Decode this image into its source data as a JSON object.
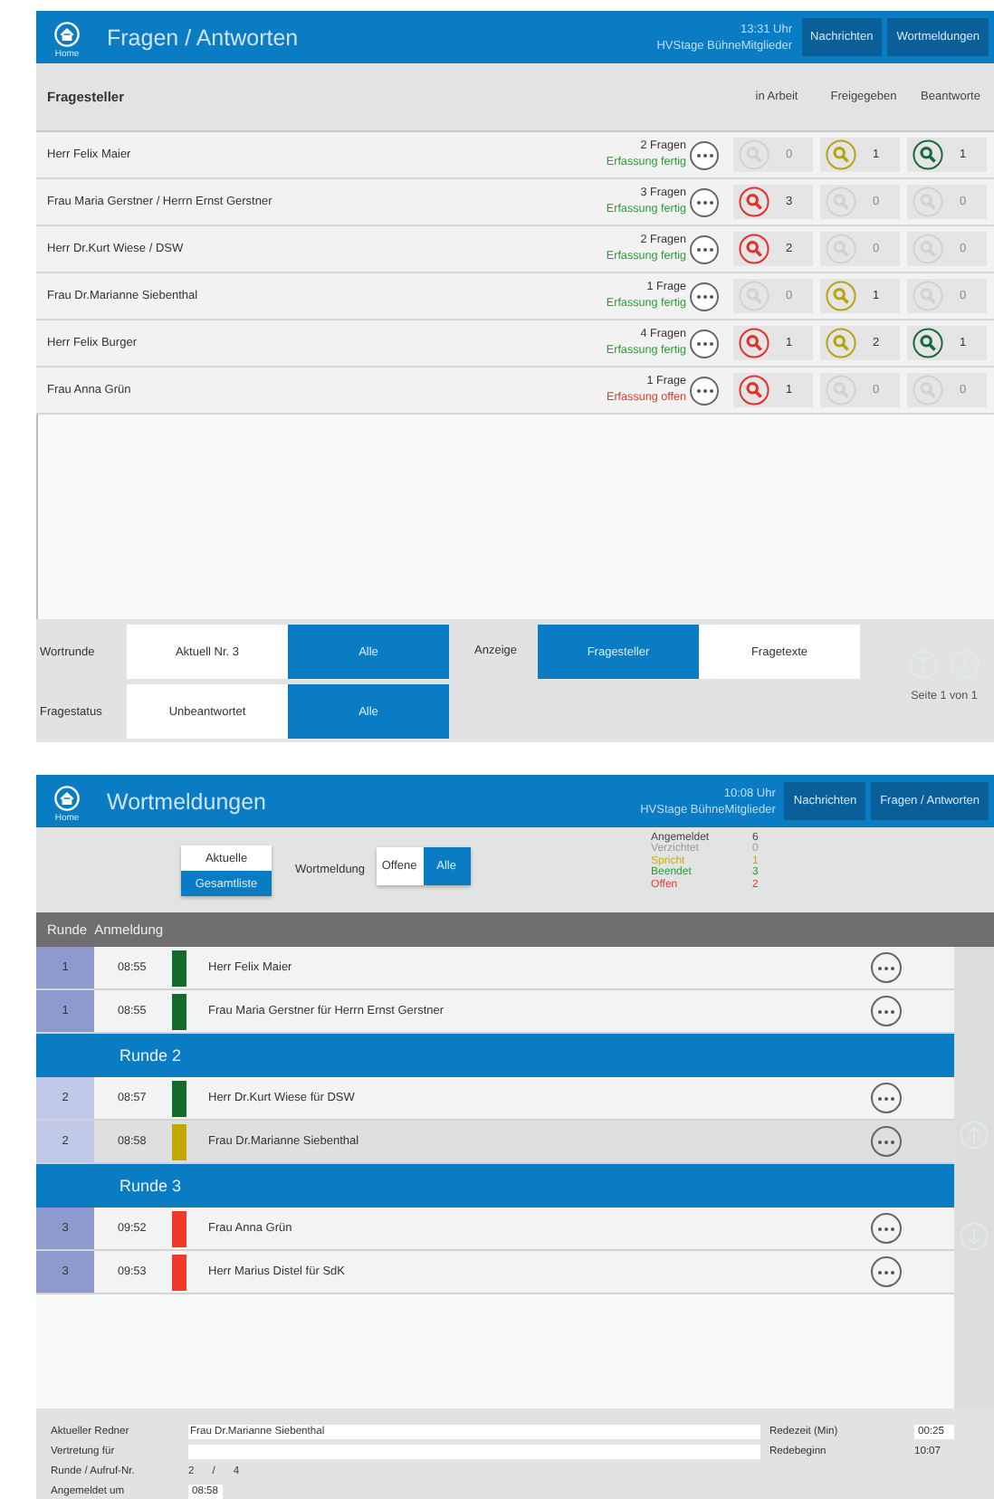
{
  "questions_screen": {
    "header": {
      "home_label": "Home",
      "title": "Fragen / Antworten",
      "time": "13:31 Uhr",
      "user": "HVStage BühneMitglieder",
      "nav_buttons": [
        "Nachrichten",
        "Wortmeldungen"
      ]
    },
    "table": {
      "columns": [
        {
          "label": "Fragesteller"
        },
        {
          "label": "in Arbeit",
          "color": "#e0322c"
        },
        {
          "label": "Freigegeben",
          "color": "#b7a412"
        },
        {
          "label": "Beantworte",
          "color": "#1a6a3a"
        }
      ],
      "rows": [
        {
          "name": "Herr Felix Maier",
          "questions": "2 Fragen",
          "status": "Erfassung fertig",
          "complete": true,
          "counts": [
            {
              "value": "0",
              "active": false
            },
            {
              "value": "1",
              "active": true
            },
            {
              "value": "1",
              "active": true
            }
          ]
        },
        {
          "name": "Frau Maria Gerstner / Herrn Ernst Gerstner",
          "questions": "3 Fragen",
          "status": "Erfassung fertig",
          "complete": true,
          "counts": [
            {
              "value": "3",
              "active": true
            },
            {
              "value": "0",
              "active": false
            },
            {
              "value": "0",
              "active": false
            }
          ]
        },
        {
          "name": "Herr Dr.Kurt Wiese / DSW",
          "questions": "2 Fragen",
          "status": "Erfassung fertig",
          "complete": true,
          "counts": [
            {
              "value": "2",
              "active": true
            },
            {
              "value": "0",
              "active": false
            },
            {
              "value": "0",
              "active": false
            }
          ]
        },
        {
          "name": "Frau Dr.Marianne Siebenthal",
          "questions": "1 Frage",
          "status": "Erfassung fertig",
          "complete": true,
          "counts": [
            {
              "value": "0",
              "active": false
            },
            {
              "value": "1",
              "active": true
            },
            {
              "value": "0",
              "active": false
            }
          ]
        },
        {
          "name": "Herr Felix Burger",
          "questions": "4 Fragen",
          "status": "Erfassung fertig",
          "complete": true,
          "counts": [
            {
              "value": "1",
              "active": true
            },
            {
              "value": "2",
              "active": true
            },
            {
              "value": "1",
              "active": true
            }
          ]
        },
        {
          "name": "Frau Anna Grün",
          "questions": "1 Frage",
          "status": "Erfassung offen",
          "complete": false,
          "counts": [
            {
              "value": "1",
              "active": true
            },
            {
              "value": "0",
              "active": false
            },
            {
              "value": "0",
              "active": false
            }
          ]
        }
      ]
    },
    "filters": [
      {
        "label": "Wortrunde",
        "options": [
          {
            "label": "Aktuell Nr. 3",
            "selected": false
          },
          {
            "label": "Alle",
            "selected": true
          }
        ]
      },
      {
        "label": "Fragestatus",
        "options": [
          {
            "label": "Unbeantwortet",
            "selected": false
          },
          {
            "label": "Alle",
            "selected": true
          }
        ]
      }
    ],
    "display": {
      "label": "Anzeige",
      "options": [
        {
          "label": "Fragesteller",
          "selected": true
        },
        {
          "label": "Fragetexte",
          "selected": false
        }
      ]
    },
    "pager": {
      "text": "Seite 1 von 1"
    }
  },
  "speakers_screen": {
    "header": {
      "home_label": "Home",
      "title": "Wortmeldungen",
      "time": "10:08 Uhr",
      "user": "HVStage BühneMitglieder",
      "nav_buttons": [
        "Nachrichten",
        "Fragen / Antworten"
      ]
    },
    "list_toggle": [
      {
        "label": "Aktuelle",
        "selected": false
      },
      {
        "label": "Gesamtliste",
        "selected": true
      }
    ],
    "filter": {
      "label": "Wortmeldung",
      "options": [
        {
          "label": "Offene",
          "selected": false
        },
        {
          "label": "Alle",
          "selected": true
        }
      ]
    },
    "stats": [
      {
        "label": "Angemeldet",
        "value": "6",
        "color": "#444444"
      },
      {
        "label": "Verzichtet",
        "value": "0",
        "color": "#9a9a9a"
      },
      {
        "label": "Spricht",
        "value": "1",
        "color": "#c9b000"
      },
      {
        "label": "Beendet",
        "value": "3",
        "color": "#2e9a3a"
      },
      {
        "label": "Offen",
        "value": "2",
        "color": "#e53935"
      }
    ],
    "list_header": [
      "Runde",
      "Anmeldung"
    ],
    "rows": [
      {
        "kind": "speaker",
        "round": "1",
        "time": "08:55",
        "name": "Herr Felix Maier",
        "color": "#136b2c",
        "selected": false
      },
      {
        "kind": "speaker",
        "round": "1",
        "time": "08:55",
        "name": "Frau Maria Gerstner für Herrn Ernst Gerstner",
        "color": "#136b2c",
        "selected": false
      },
      {
        "kind": "round",
        "label": "Runde 2"
      },
      {
        "kind": "speaker",
        "round": "2",
        "time": "08:57",
        "name": "Herr Dr.Kurt Wiese für DSW",
        "color": "#136b2c",
        "selected": false
      },
      {
        "kind": "speaker",
        "round": "2",
        "time": "08:58",
        "name": "Frau Dr.Marianne Siebenthal",
        "color": "#c2a800",
        "selected": true
      },
      {
        "kind": "round",
        "label": "Runde 3"
      },
      {
        "kind": "speaker",
        "round": "3",
        "time": "09:52",
        "name": "Frau Anna Grün",
        "color": "#ee3a2a",
        "selected": false
      },
      {
        "kind": "speaker",
        "round": "3",
        "time": "09:53",
        "name": "Herr Marius Distel für SdK",
        "color": "#ee3a2a",
        "selected": false
      }
    ],
    "details": {
      "current_speaker": {
        "label": "Aktueller Redner",
        "value": "Frau Dr.Marianne Siebenthal"
      },
      "proxy_for": {
        "label": "Vertretung für"
      },
      "round_call": {
        "label": "Runde / Aufruf-Nr.",
        "round": "2",
        "separator": "/",
        "call": "4"
      },
      "registered_at": {
        "label": "Angemeldet um",
        "value": "08:58"
      },
      "speaking_time": {
        "label": "Redezeit (Min)",
        "value": "00:25"
      },
      "speech_start": {
        "label": "Redebeginn",
        "value": "10:07"
      }
    }
  }
}
